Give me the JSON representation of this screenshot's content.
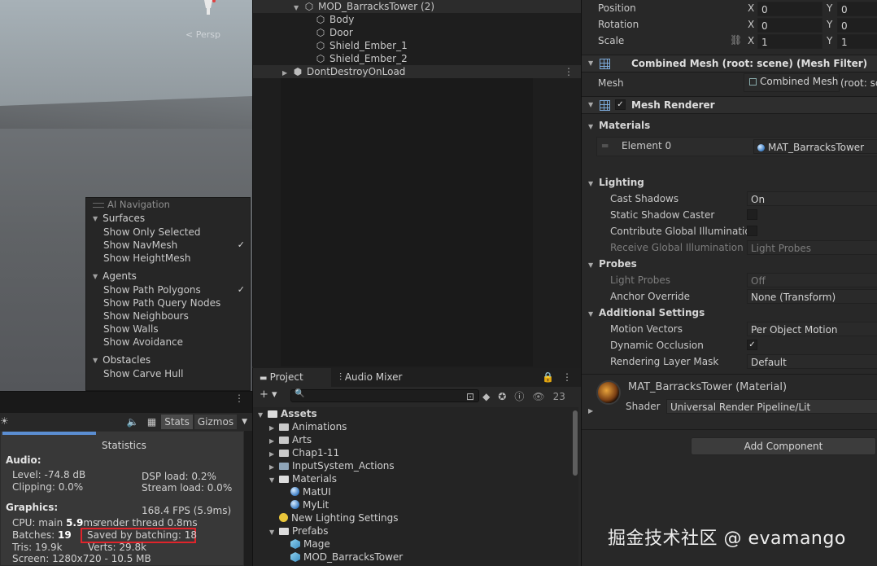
{
  "scene": {
    "persp_label": "< Persp",
    "ai_navigation": {
      "header": "AI Navigation",
      "sections": [
        {
          "title": "Surfaces",
          "items": [
            {
              "label": "Show Only Selected",
              "checked": false
            },
            {
              "label": "Show NavMesh",
              "checked": true
            },
            {
              "label": "Show HeightMesh",
              "checked": false
            }
          ]
        },
        {
          "title": "Agents",
          "items": [
            {
              "label": "Show Path Polygons",
              "checked": true
            },
            {
              "label": "Show Path Query Nodes",
              "checked": false
            },
            {
              "label": "Show Neighbours",
              "checked": false
            },
            {
              "label": "Show Walls",
              "checked": false
            },
            {
              "label": "Show Avoidance",
              "checked": false
            }
          ]
        },
        {
          "title": "Obstacles",
          "items": [
            {
              "label": "Show Carve Hull",
              "checked": false
            }
          ]
        }
      ]
    },
    "toolbar": {
      "stats_label": "Stats",
      "gizmos_label": "Gizmos"
    }
  },
  "stats": {
    "title": "Statistics",
    "audio_label": "Audio:",
    "level": "Level: -74.8 dB",
    "clipping": "Clipping: 0.0%",
    "dsp_load": "DSP load: 0.2%",
    "stream_load": "Stream load: 0.0%",
    "graphics_label": "Graphics:",
    "fps": "168.4 FPS (5.9ms)",
    "cpu_main_prefix": "CPU: main ",
    "cpu_main_value": "5.9",
    "cpu_main_suffix": "ms",
    "render_thread": "render thread 0.8ms",
    "batches_prefix": "Batches: ",
    "batches_value": "19",
    "saved_by_batching": "Saved by batching: 18",
    "tris": "Tris: 19.9k",
    "verts": "Verts: 29.8k",
    "screen": "Screen: 1280x720 - 10.5 MB"
  },
  "hierarchy": {
    "rows": [
      {
        "label": "MOD_BarracksTower (2)",
        "indent": 2,
        "expanded": true,
        "icon": "prefab-cube-icon"
      },
      {
        "label": "Body",
        "indent": 3,
        "icon": "cube-icon"
      },
      {
        "label": "Door",
        "indent": 3,
        "icon": "cube-icon"
      },
      {
        "label": "Shield_Ember_1",
        "indent": 3,
        "icon": "cube-icon"
      },
      {
        "label": "Shield_Ember_2",
        "indent": 3,
        "icon": "cube-icon"
      },
      {
        "label": "DontDestroyOnLoad",
        "indent": 0,
        "expanded": false,
        "icon": "unity-logo-icon"
      }
    ]
  },
  "project": {
    "tabs": [
      {
        "label": "Project"
      },
      {
        "label": "Audio Mixer"
      }
    ],
    "hidden_count": "23",
    "tree": [
      {
        "label": "Assets",
        "depth": 0,
        "type": "folder-open",
        "bold": true
      },
      {
        "label": "Animations",
        "depth": 1,
        "type": "folder"
      },
      {
        "label": "Arts",
        "depth": 1,
        "type": "folder"
      },
      {
        "label": "Chap1-11",
        "depth": 1,
        "type": "folder"
      },
      {
        "label": "InputSystem_Actions",
        "depth": 1,
        "type": "input-actions"
      },
      {
        "label": "Materials",
        "depth": 1,
        "type": "folder-open"
      },
      {
        "label": "MatUI",
        "depth": 2,
        "type": "material"
      },
      {
        "label": "MyLit",
        "depth": 2,
        "type": "material"
      },
      {
        "label": "New Lighting Settings",
        "depth": 1,
        "type": "lighting"
      },
      {
        "label": "Prefabs",
        "depth": 1,
        "type": "folder-open"
      },
      {
        "label": "Mage",
        "depth": 2,
        "type": "prefab"
      },
      {
        "label": "MOD_BarracksTower",
        "depth": 2,
        "type": "prefab"
      }
    ]
  },
  "inspector": {
    "transform": {
      "position_label": "Position",
      "rotation_label": "Rotation",
      "scale_label": "Scale",
      "x_axis": "X",
      "y_axis": "Y",
      "position": {
        "x": "0",
        "y": "0"
      },
      "rotation": {
        "x": "0",
        "y": "0"
      },
      "scale": {
        "x": "1",
        "y": "1"
      }
    },
    "mesh_filter": {
      "title": "Combined Mesh (root: scene) (Mesh Filter)",
      "mesh_label": "Mesh",
      "mesh_value": "Combined Mesh",
      "mesh_value_tail": "(root: scene)"
    },
    "mesh_renderer": {
      "title": "Mesh Renderer",
      "enabled": true,
      "materials_label": "Materials",
      "element_label": "Element 0",
      "element_value": "MAT_BarracksTower",
      "lighting_label": "Lighting",
      "cast_shadows_label": "Cast Shadows",
      "cast_shadows_value": "On",
      "static_shadow_caster_label": "Static Shadow Caster",
      "contribute_gi_label": "Contribute Global Illumination",
      "receive_gi_label": "Receive Global Illumination",
      "receive_gi_value": "Light Probes",
      "probes_label": "Probes",
      "light_probes_label": "Light Probes",
      "light_probes_value": "Off",
      "anchor_override_label": "Anchor Override",
      "anchor_override_value": "None (Transform)",
      "additional_label": "Additional Settings",
      "motion_vectors_label": "Motion Vectors",
      "motion_vectors_value": "Per Object Motion",
      "dynamic_occlusion_label": "Dynamic Occlusion",
      "dynamic_occlusion_checked": true,
      "rendering_layer_mask_label": "Rendering Layer Mask",
      "rendering_layer_mask_value": "Default"
    },
    "material": {
      "name": "MAT_BarracksTower (Material)",
      "shader_label": "Shader",
      "shader_value": "Universal Render Pipeline/Lit"
    },
    "add_component": "Add Component"
  },
  "watermark": "掘金技术社区 @ evamango",
  "colors": {
    "highlight_box": "#e0242b",
    "stats_accent": "#5b8ed2",
    "panel_bg": "#282828",
    "dark_bg": "#1e1e1e"
  }
}
